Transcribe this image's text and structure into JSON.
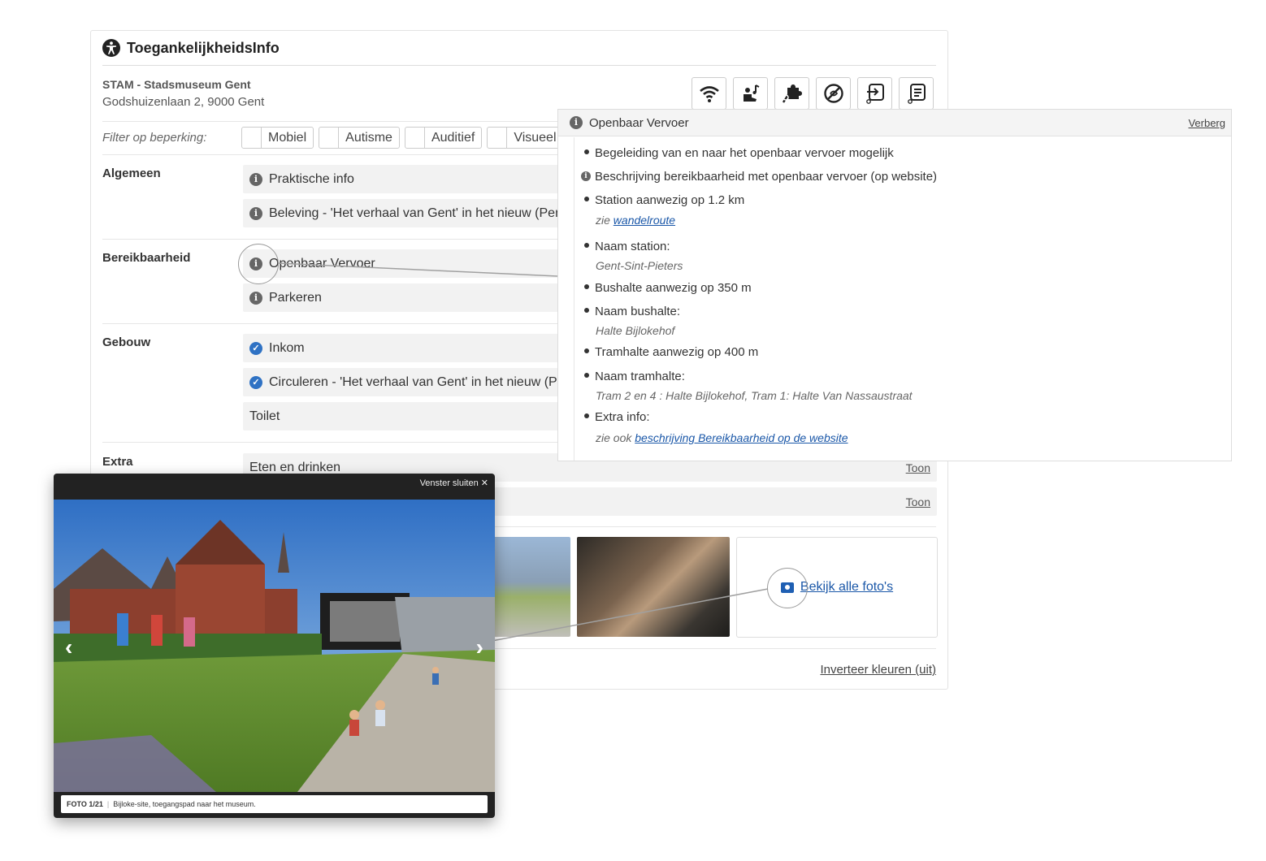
{
  "card": {
    "title": "ToegankelijkheidsInfo",
    "museum_name": "STAM - Stadsmuseum Gent",
    "address": "Godshuizenlaan 2, 9000 Gent",
    "filter_label": "Filter op beperking:",
    "filters": [
      "Mobiel",
      "Autisme",
      "Auditief",
      "Visueel"
    ],
    "sections": {
      "algemeen": "Algemeen",
      "bereikbaarheid": "Bereikbaarheid",
      "gebouw": "Gebouw",
      "extra": "Extra"
    },
    "rows": {
      "praktische": "Praktische info",
      "beleving": "Beleving - 'Het verhaal van Gent' in het nieuw (Pern",
      "openbaar": "Openbaar Vervoer",
      "parkeren": "Parkeren",
      "inkom": "Inkom",
      "circuleren": "Circuleren - 'Het verhaal van Gent' in het nieuw (Pe",
      "toilet": "Toilet",
      "eten": "Eten en drinken"
    },
    "toon": "Toon",
    "all_photos": "Bekijk alle foto's",
    "invert": "Inverteer kleuren (uit)",
    "feature_icons": [
      "wifi-icon",
      "wheelchair-music-icon",
      "puzzle-icon",
      "no-perfume-icon",
      "accessible-exit-icon",
      "accessible-text-icon"
    ]
  },
  "popup": {
    "title": "Openbaar Vervoer",
    "hide": "Verberg",
    "items": {
      "begeleiding": "Begeleiding van en naar het openbaar vervoer mogelijk",
      "beschrijving": "Beschrijving bereikbaarheid met openbaar vervoer (op website)",
      "station": "Station aanwezig op 1.2 km",
      "station_sub_prefix": "zie",
      "station_sub_link": "wandelroute",
      "naam_station": "Naam station:",
      "naam_station_val": "Gent-Sint-Pieters",
      "bushalte": "Bushalte aanwezig op 350 m",
      "naam_bushalte": "Naam bushalte:",
      "naam_bushalte_val": "Halte Bijlokehof",
      "tramhalte": "Tramhalte aanwezig op 400 m",
      "naam_tramhalte": "Naam tramhalte:",
      "naam_tramhalte_val": "Tram 2 en 4 : Halte Bijlokehof, Tram 1: Halte Van Nassaustraat",
      "extra": "Extra info:",
      "extra_prefix": "zie ook",
      "extra_link": "beschrijving Bereikbaarheid op de website"
    }
  },
  "lightbox": {
    "close": "Venster sluiten ✕",
    "counter": "FOTO 1/21",
    "caption": "Bijloke-site, toegangspad naar het museum."
  },
  "colors": {
    "link": "#1a57a8",
    "check": "#2f72c4"
  }
}
